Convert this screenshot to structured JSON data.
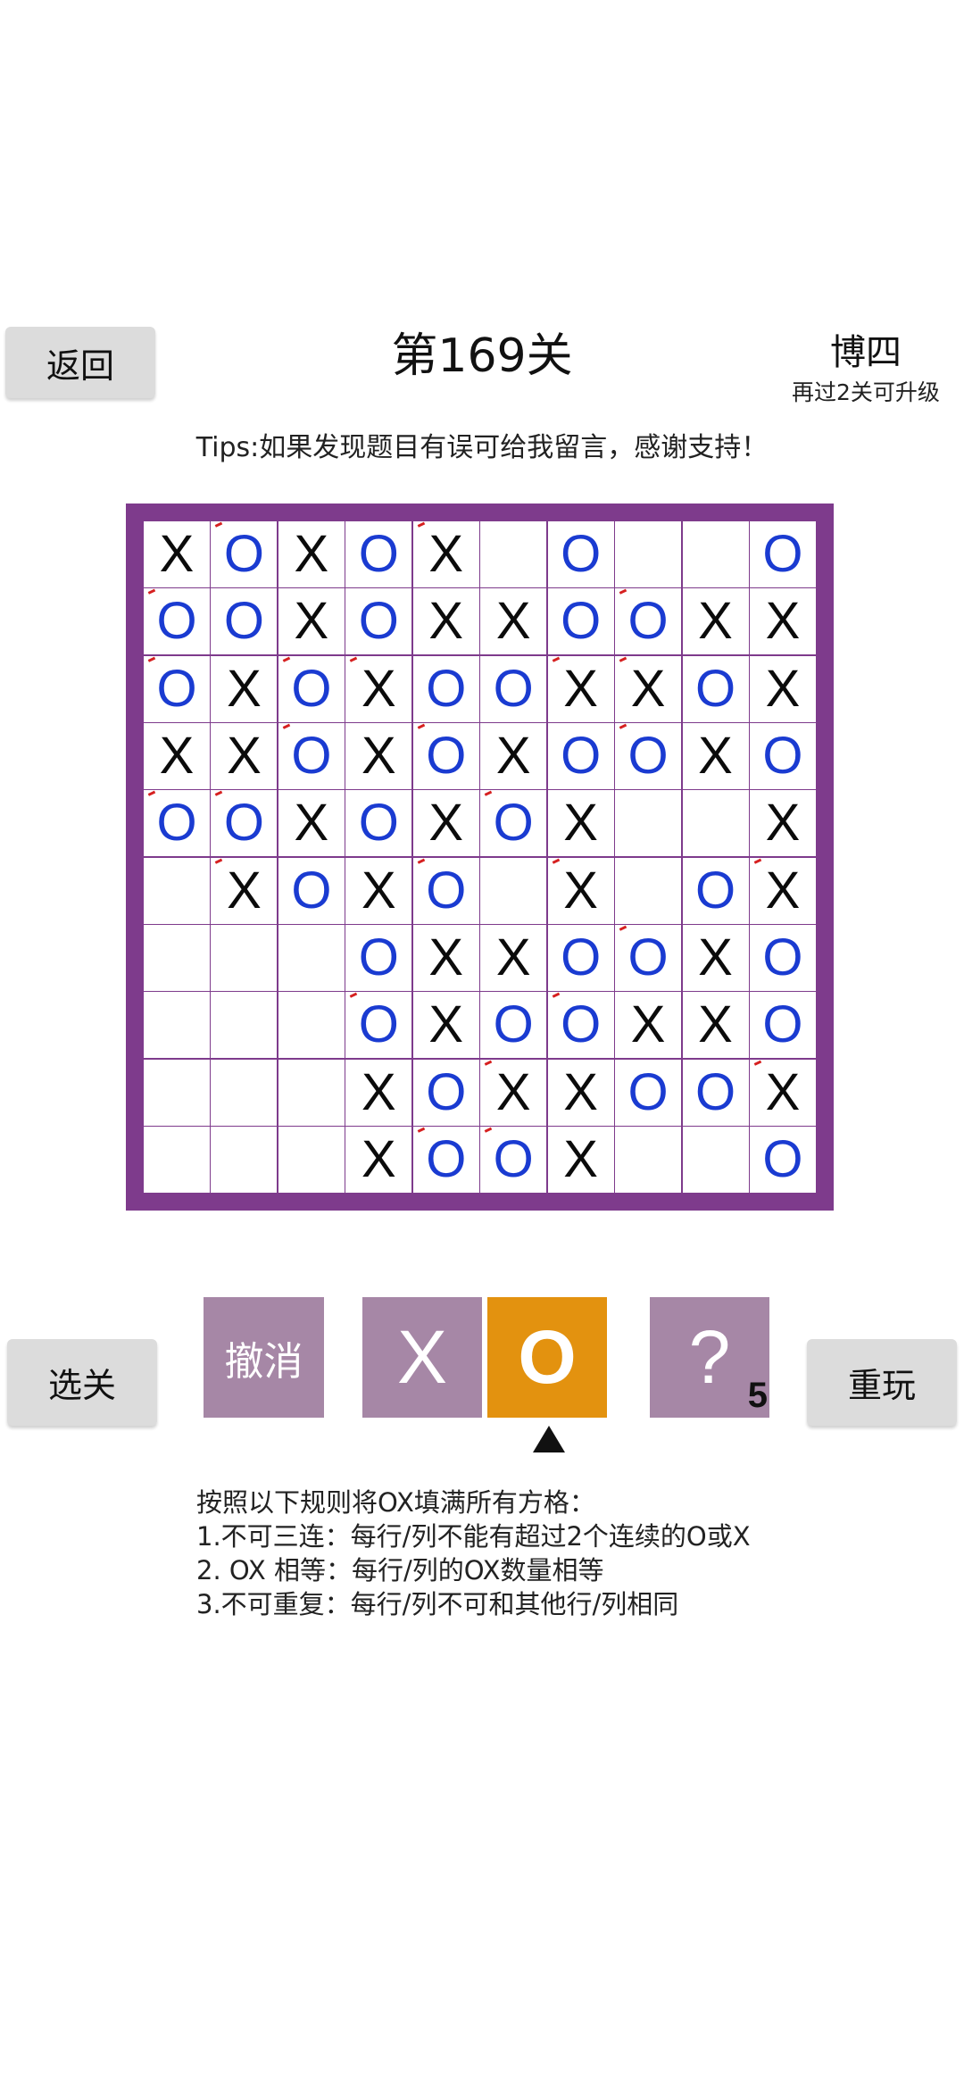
{
  "header": {
    "back_label": "返回",
    "title": "第169关",
    "rank": "博四",
    "rank_sub": "再过2关可升级",
    "tips": "Tips:如果发现题目有误可给我留言，感谢支持！"
  },
  "board": {
    "rows": [
      [
        "X",
        "O",
        "X",
        "O",
        "X",
        "",
        "O",
        "",
        "",
        "O"
      ],
      [
        "O",
        "O",
        "X",
        "O",
        "X",
        "X",
        "O",
        "O",
        "X",
        "X"
      ],
      [
        "O",
        "X",
        "O",
        "X",
        "O",
        "O",
        "X",
        "X",
        "O",
        "X"
      ],
      [
        "X",
        "X",
        "O",
        "X",
        "O",
        "X",
        "O",
        "O",
        "X",
        "O"
      ],
      [
        "O",
        "O",
        "X",
        "O",
        "X",
        "O",
        "X",
        "",
        "",
        "X"
      ],
      [
        "",
        "X",
        "O",
        "X",
        "O",
        "",
        "X",
        "",
        "O",
        "X"
      ],
      [
        "",
        "",
        "",
        "O",
        "X",
        "X",
        "O",
        "O",
        "X",
        "O"
      ],
      [
        "",
        "",
        "",
        "O",
        "X",
        "O",
        "O",
        "X",
        "X",
        "O"
      ],
      [
        "",
        "",
        "",
        "X",
        "O",
        "X",
        "X",
        "O",
        "O",
        "X"
      ],
      [
        "",
        "",
        "",
        "X",
        "O",
        "O",
        "X",
        "",
        "",
        "O"
      ]
    ],
    "marked": [
      [
        0,
        1
      ],
      [
        0,
        4
      ],
      [
        1,
        0
      ],
      [
        1,
        7
      ],
      [
        2,
        0
      ],
      [
        2,
        2
      ],
      [
        2,
        3
      ],
      [
        2,
        6
      ],
      [
        2,
        7
      ],
      [
        3,
        2
      ],
      [
        3,
        4
      ],
      [
        3,
        7
      ],
      [
        4,
        0
      ],
      [
        4,
        1
      ],
      [
        4,
        5
      ],
      [
        5,
        1
      ],
      [
        5,
        4
      ],
      [
        5,
        6
      ],
      [
        5,
        9
      ],
      [
        6,
        7
      ],
      [
        7,
        3
      ],
      [
        7,
        6
      ],
      [
        8,
        5
      ],
      [
        8,
        9
      ],
      [
        9,
        4
      ],
      [
        9,
        5
      ]
    ]
  },
  "controls": {
    "select_label": "选关",
    "undo_label": "撤消",
    "x_label": "X",
    "o_label": "O",
    "hint_label": "?",
    "hint_count": "5",
    "replay_label": "重玩",
    "selected": "O"
  },
  "rules": {
    "lines": [
      "按照以下规则将OX填满所有方格：",
      "1.不可三连：每行/列不能有超过2个连续的O或X",
      "2. OX 相等：每行/列的OX数量相等",
      "3.不可重复：每行/列不可和其他行/列相同"
    ]
  },
  "colors": {
    "board_border": "#7e3b8c",
    "x_color": "#0b0b0b",
    "o_color": "#1a3bd1",
    "button_purple": "#a687a6",
    "button_selected": "#e3920f",
    "button_gray": "#dcdcdc",
    "mark_red": "#d62020"
  }
}
